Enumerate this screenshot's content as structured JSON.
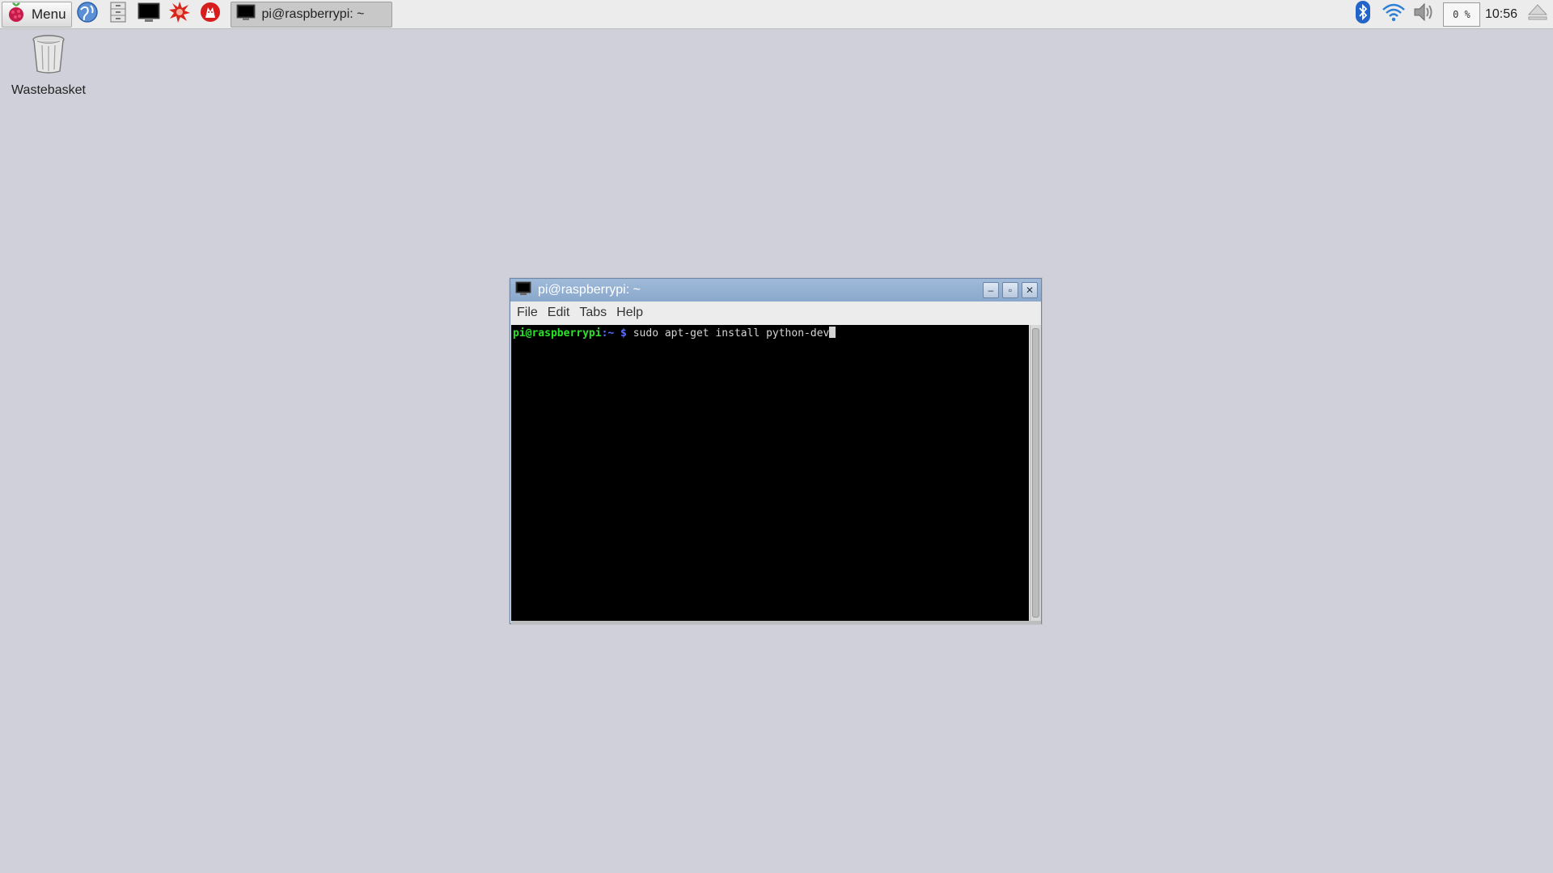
{
  "panel": {
    "menu_label": "Menu",
    "task_title": "pi@raspberrypi: ~",
    "cpu_usage": "0 %",
    "clock": "10:56"
  },
  "desktop": {
    "icons": [
      {
        "label": "Wastebasket",
        "icon": "wastebasket-icon"
      }
    ]
  },
  "terminal": {
    "title": "pi@raspberrypi: ~",
    "menu": [
      "File",
      "Edit",
      "Tabs",
      "Help"
    ],
    "prompt_user": "pi@raspberrypi",
    "prompt_path": ":~",
    "prompt_symbol": " $ ",
    "command": "sudo apt-get install python-dev"
  },
  "colors": {
    "desktop_bg": "#d0d0da",
    "titlebar": "#8aa8cc",
    "prompt_user": "#2be22b",
    "prompt_path": "#5a6cff"
  }
}
